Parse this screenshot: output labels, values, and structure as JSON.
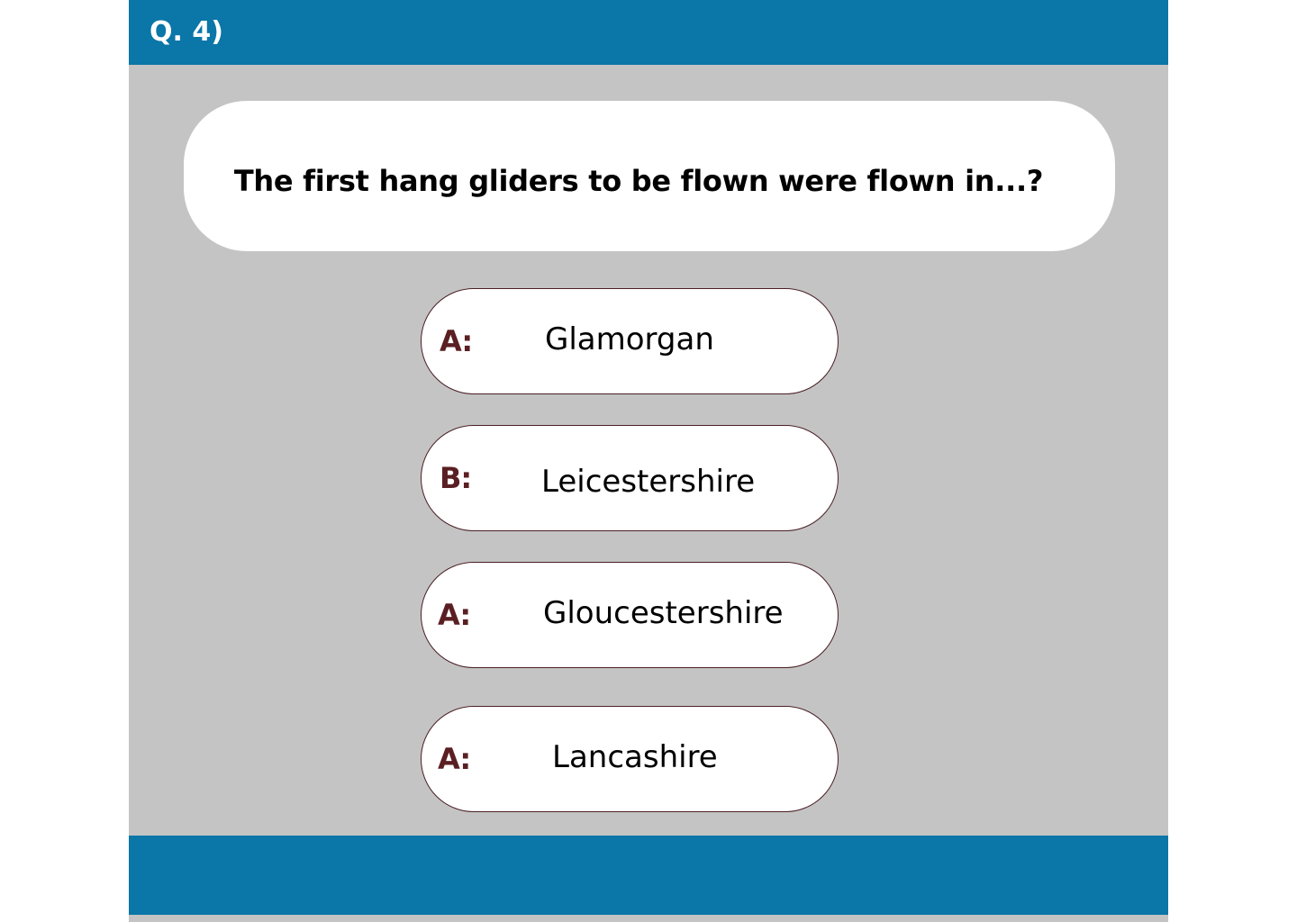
{
  "header": {
    "question_number": "Q. 4)"
  },
  "question": {
    "text": "The first hang gliders to be flown were flown in...?"
  },
  "answers": [
    {
      "letter": "A:",
      "text": "Glamorgan"
    },
    {
      "letter": "B:",
      "text": "Leicestershire"
    },
    {
      "letter": "A:",
      "text": "Gloucestershire"
    },
    {
      "letter": "A:",
      "text": "Lancashire"
    }
  ],
  "colors": {
    "header_footer": "#0b76a8",
    "background": "#c4c4c4",
    "answer_letter": "#5a1f22",
    "answer_border": "#4a1f24"
  }
}
